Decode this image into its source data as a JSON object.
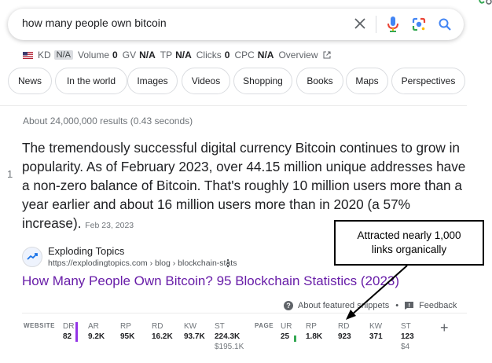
{
  "search": {
    "query": "how many people own bitcoin"
  },
  "metrics": {
    "kd_label": "KD",
    "kd_value": "N/A",
    "volume_label": "Volume",
    "volume_value": "0",
    "gv_label": "GV",
    "gv_value": "N/A",
    "tp_label": "TP",
    "tp_value": "N/A",
    "clicks_label": "Clicks",
    "clicks_value": "0",
    "cpc_label": "CPC",
    "cpc_value": "N/A",
    "overview_label": "Overview"
  },
  "chips": [
    "News",
    "In the world",
    "Images",
    "Videos",
    "Shopping",
    "Books",
    "Maps",
    "Perspectives"
  ],
  "results_stats": "About 24,000,000 results (0.43 seconds)",
  "snippet": {
    "index": "1",
    "text": "The tremendously successful digital currency Bitcoin continues to grow in popularity. As of February 2023, over 44.15 million unique addresses have a non-zero balance of Bitcoin. That's roughly 10 million users more than a year earlier and about 16 million users more than in 2020 (a 57% increase).",
    "date": "Feb 23, 2023"
  },
  "source": {
    "site_name": "Exploding Topics",
    "url": "https://explodingtopics.com › blog › blockchain-stats",
    "title": "How Many People Own Bitcoin? 95 Blockchain Statistics (2023)"
  },
  "about": {
    "featured_label": "About featured snippets",
    "separator": "•",
    "feedback_label": "Feedback"
  },
  "seo": {
    "website_label": "WEBSITE",
    "page_label": "PAGE",
    "website": [
      {
        "label": "DR",
        "value": "82"
      },
      {
        "label": "AR",
        "value": "9.2K"
      },
      {
        "label": "RP",
        "value": "95K"
      },
      {
        "label": "RD",
        "value": "16.2K"
      },
      {
        "label": "KW",
        "value": "93.7K"
      },
      {
        "label": "ST",
        "value": "224.3K",
        "sub": "$195.1K"
      }
    ],
    "page": [
      {
        "label": "UR",
        "value": "25"
      },
      {
        "label": "RP",
        "value": "1.8K"
      },
      {
        "label": "RD",
        "value": "923"
      },
      {
        "label": "KW",
        "value": "371"
      },
      {
        "label": "ST",
        "value": "123",
        "sub": "$4"
      }
    ],
    "plus": "+"
  },
  "callout": {
    "line1": "Attracted nearly 1,000",
    "line2": "links organically"
  },
  "colors": {
    "link_visited": "#681da8",
    "dr_bar": "#9334e6",
    "ur_bar": "#34a853",
    "mic_blue": "#4285f4",
    "mic_red": "#ea4335"
  }
}
